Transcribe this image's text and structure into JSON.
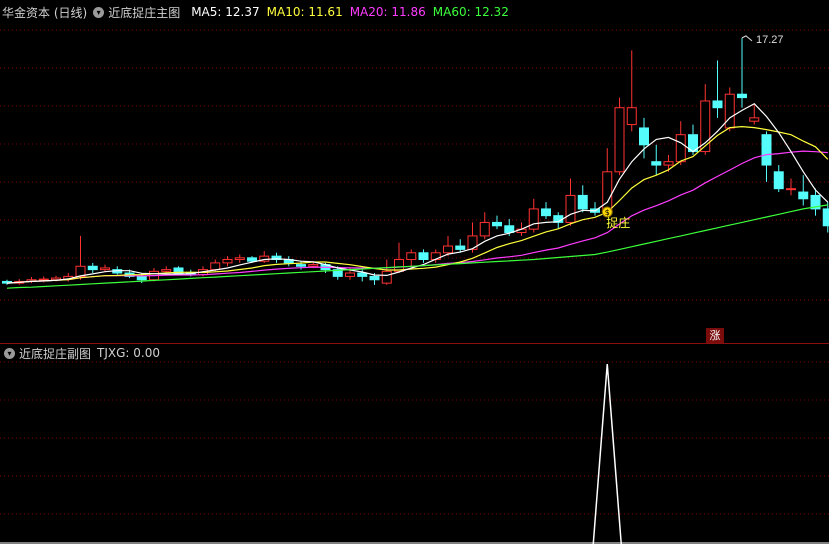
{
  "main_panel": {
    "title": "华金资本 (日线)",
    "indicator_name": "近底捉庄主图",
    "ma": [
      {
        "label": "MA5:",
        "value": "12.37",
        "color": "#ffffff"
      },
      {
        "label": "MA10:",
        "value": "11.61",
        "color": "#ffff3c"
      },
      {
        "label": "MA20:",
        "value": "11.86",
        "color": "#ff3cff"
      },
      {
        "label": "MA60:",
        "value": "12.32",
        "color": "#3cff3c"
      }
    ],
    "high_label": "17.27",
    "signal_label": "捉庄",
    "signal_badge": "$",
    "zhang_badge": "涨"
  },
  "sub_panel": {
    "indicator_name": "近底捉庄副图",
    "value_text": "TJXG: 0.00"
  },
  "colors": {
    "up": "#ff3232",
    "down": "#54fcfc",
    "grid": "#7a0000",
    "ma5": "#ffffff",
    "ma10": "#ffff3c",
    "ma20": "#ff3cff",
    "ma60": "#3cff3c"
  },
  "chart_data": {
    "type": "candlestick",
    "price_range": [
      9.5,
      17.8
    ],
    "candles": [
      [
        10.05,
        10.0,
        10.1,
        9.95
      ],
      [
        10.0,
        10.05,
        10.12,
        9.95
      ],
      [
        10.05,
        10.1,
        10.18,
        10.0
      ],
      [
        10.1,
        10.12,
        10.2,
        10.02
      ],
      [
        10.1,
        10.15,
        10.22,
        10.05
      ],
      [
        10.12,
        10.2,
        10.3,
        10.05
      ],
      [
        10.2,
        10.5,
        11.4,
        10.1
      ],
      [
        10.5,
        10.4,
        10.6,
        10.3
      ],
      [
        10.4,
        10.45,
        10.55,
        10.35
      ],
      [
        10.4,
        10.3,
        10.5,
        10.25
      ],
      [
        10.3,
        10.2,
        10.4,
        10.15
      ],
      [
        10.2,
        10.1,
        10.3,
        10.0
      ],
      [
        10.1,
        10.35,
        10.45,
        10.05
      ],
      [
        10.35,
        10.4,
        10.5,
        10.3
      ],
      [
        10.45,
        10.3,
        10.5,
        10.25
      ],
      [
        10.3,
        10.25,
        10.4,
        10.2
      ],
      [
        10.25,
        10.4,
        10.5,
        10.2
      ],
      [
        10.4,
        10.6,
        10.7,
        10.35
      ],
      [
        10.6,
        10.7,
        10.8,
        10.5
      ],
      [
        10.7,
        10.75,
        10.85,
        10.6
      ],
      [
        10.75,
        10.65,
        10.8,
        10.6
      ],
      [
        10.65,
        10.8,
        10.95,
        10.6
      ],
      [
        10.8,
        10.7,
        10.9,
        10.6
      ],
      [
        10.7,
        10.6,
        10.8,
        10.5
      ],
      [
        10.55,
        10.5,
        10.65,
        10.4
      ],
      [
        10.5,
        10.55,
        10.65,
        10.45
      ],
      [
        10.55,
        10.4,
        10.6,
        10.3
      ],
      [
        10.4,
        10.2,
        10.5,
        10.1
      ],
      [
        10.2,
        10.3,
        10.45,
        10.1
      ],
      [
        10.3,
        10.2,
        10.4,
        10.05
      ],
      [
        10.2,
        10.1,
        10.3,
        9.95
      ],
      [
        10.0,
        10.35,
        10.7,
        9.95
      ],
      [
        10.35,
        10.7,
        11.2,
        10.3
      ],
      [
        10.7,
        10.9,
        11.0,
        10.5
      ],
      [
        10.9,
        10.7,
        11.0,
        10.6
      ],
      [
        10.7,
        10.9,
        11.0,
        10.6
      ],
      [
        10.9,
        11.1,
        11.4,
        10.8
      ],
      [
        11.1,
        11.0,
        11.3,
        10.9
      ],
      [
        11.0,
        11.4,
        11.8,
        10.9
      ],
      [
        11.4,
        11.8,
        12.1,
        11.3
      ],
      [
        11.8,
        11.7,
        12.0,
        11.6
      ],
      [
        11.7,
        11.5,
        11.9,
        11.4
      ],
      [
        11.5,
        11.6,
        11.8,
        11.4
      ],
      [
        11.6,
        12.2,
        12.5,
        11.5
      ],
      [
        12.2,
        12.0,
        12.4,
        11.9
      ],
      [
        12.0,
        11.8,
        12.1,
        11.6
      ],
      [
        11.8,
        12.6,
        13.1,
        11.7
      ],
      [
        12.6,
        12.2,
        12.9,
        12.1
      ],
      [
        12.2,
        12.1,
        12.4,
        12.0
      ],
      [
        12.1,
        13.3,
        14.0,
        12.0
      ],
      [
        13.3,
        15.2,
        15.5,
        13.2
      ],
      [
        14.7,
        15.2,
        16.9,
        14.5
      ],
      [
        14.6,
        14.1,
        14.9,
        13.7
      ],
      [
        13.6,
        13.5,
        14.1,
        13.2
      ],
      [
        13.5,
        13.6,
        13.8,
        13.3
      ],
      [
        13.6,
        14.4,
        14.8,
        13.5
      ],
      [
        14.4,
        13.9,
        14.7,
        13.8
      ],
      [
        13.9,
        15.4,
        15.9,
        13.8
      ],
      [
        15.4,
        15.2,
        16.6,
        14.9
      ],
      [
        14.6,
        15.6,
        15.8,
        14.5
      ],
      [
        15.6,
        15.5,
        17.27,
        15.2
      ],
      [
        14.8,
        14.9,
        15.3,
        14.7
      ],
      [
        14.4,
        13.5,
        14.5,
        13.0
      ],
      [
        13.3,
        12.8,
        13.5,
        12.7
      ],
      [
        12.8,
        12.8,
        13.1,
        12.6
      ],
      [
        12.7,
        12.5,
        13.2,
        12.3
      ],
      [
        12.6,
        12.2,
        12.8,
        12.0
      ],
      [
        12.2,
        11.7,
        12.4,
        11.5
      ]
    ],
    "ma60": [
      9.85,
      9.87,
      9.88,
      9.9,
      9.92,
      9.94,
      9.96,
      9.98,
      10.0,
      10.02,
      10.04,
      10.06,
      10.08,
      10.1,
      10.12,
      10.14,
      10.16,
      10.18,
      10.2,
      10.22,
      10.24,
      10.26,
      10.28,
      10.3,
      10.32,
      10.34,
      10.36,
      10.38,
      10.4,
      10.42,
      10.44,
      10.46,
      10.48,
      10.5,
      10.52,
      10.54,
      10.56,
      10.58,
      10.6,
      10.62,
      10.64,
      10.66,
      10.68,
      10.7,
      10.73,
      10.76,
      10.79,
      10.82,
      10.85,
      10.92,
      11.0,
      11.08,
      11.16,
      11.24,
      11.32,
      11.4,
      11.48,
      11.56,
      11.64,
      11.72,
      11.8,
      11.88,
      11.96,
      12.04,
      12.12,
      12.2,
      12.26,
      12.32
    ]
  },
  "sub_chart": {
    "spike_index": 49,
    "value_max": 1
  }
}
